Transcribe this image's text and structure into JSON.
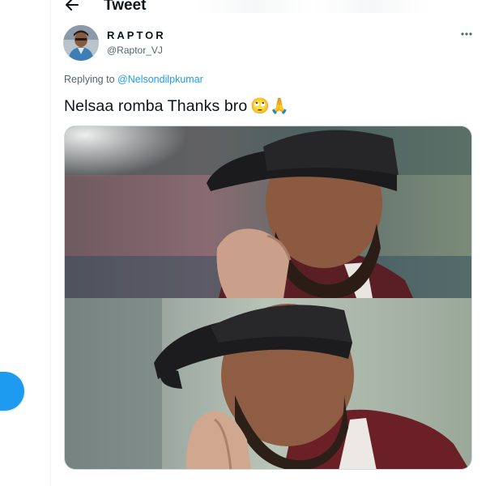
{
  "header": {
    "title": "Tweet"
  },
  "tweet": {
    "author_name": "RAPTOR",
    "author_handle": "@Raptor_VJ",
    "replying_prefix": "Replying to",
    "replying_to": "@Nelsondilpkumar",
    "text": "Nelsaa romba Thanks bro",
    "emojis": "🙄🙏"
  },
  "colors": {
    "accent": "#1d9bf0",
    "secondary_text": "#536471",
    "primary_text": "#0f1419"
  },
  "icons": [
    "back-arrow-icon",
    "more-icon",
    "compose-icon"
  ]
}
